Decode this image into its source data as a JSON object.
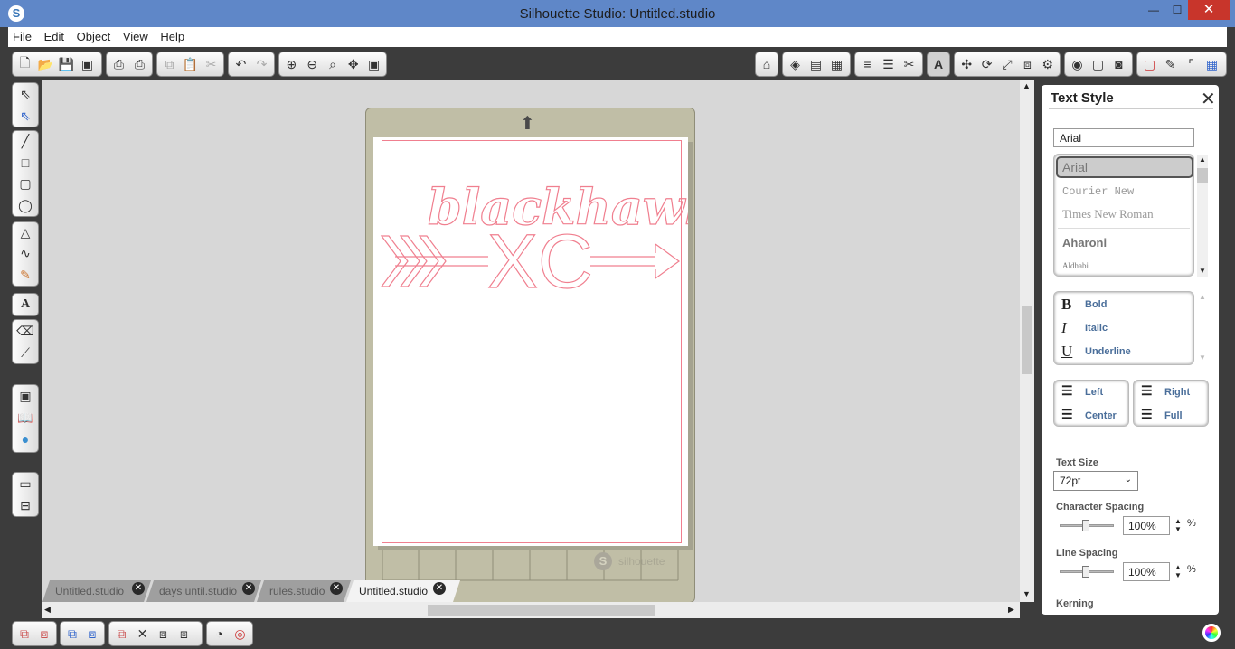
{
  "window": {
    "title": "Silhouette Studio: Untitled.studio",
    "minimize": "—",
    "maximize": "☐",
    "close": "✕"
  },
  "menu": [
    "File",
    "Edit",
    "Object",
    "View",
    "Help"
  ],
  "artwork": {
    "word": "blackhawk",
    "letters": "XC"
  },
  "mat": {
    "brand": "silhouette"
  },
  "tabs": [
    {
      "label": "Untitled.studio"
    },
    {
      "label": "days until.studio"
    },
    {
      "label": "rules.studio"
    },
    {
      "label": "Untitled.studio"
    }
  ],
  "panel": {
    "title": "Text Style",
    "font_value": "Arial",
    "fonts": [
      "Arial",
      "Courier New",
      "Times New Roman",
      "Aharoni",
      "Aldhabi"
    ],
    "styles": [
      {
        "icon": "B",
        "label": "Bold"
      },
      {
        "icon": "I",
        "label": "Italic"
      },
      {
        "icon": "U",
        "label": "Underline"
      }
    ],
    "align": {
      "left": "Left",
      "center": "Center",
      "right": "Right",
      "full": "Full"
    },
    "text_size_label": "Text Size",
    "text_size_value": "72pt",
    "char_spacing_label": "Character Spacing",
    "char_spacing_value": "100%",
    "line_spacing_label": "Line Spacing",
    "line_spacing_value": "100%",
    "pct": "%",
    "kerning_label": "Kerning"
  },
  "colors": {
    "titlebar": "#5f87c8",
    "cutline": "#f07f8f",
    "mat": "#c0bea6",
    "chrome": "#3c3c3c",
    "link_blue": "#4a6e9a"
  }
}
